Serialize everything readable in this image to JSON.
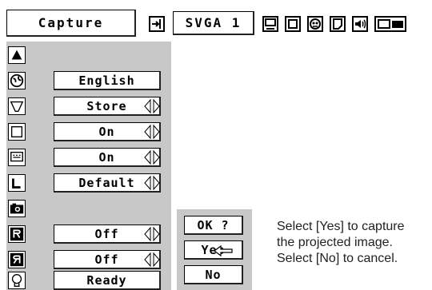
{
  "header": {
    "title": "Capture",
    "signal": "SVGA 1",
    "icons": [
      "input-icon",
      "screen-icon",
      "picture-icon",
      "color-icon",
      "image-adjust-icon",
      "sound-icon",
      "setting-icon"
    ]
  },
  "menu": {
    "items": [
      {
        "icon": "up-arrow-icon",
        "value": ""
      },
      {
        "icon": "globe-icon",
        "value": "English"
      },
      {
        "icon": "keystone-icon",
        "value": "Store"
      },
      {
        "icon": "blue-back-icon",
        "value": "On"
      },
      {
        "icon": "display-icon",
        "value": "On"
      },
      {
        "icon": "logo-icon",
        "value": "Default"
      },
      {
        "icon": "capture-icon",
        "value": ""
      },
      {
        "icon": "ceiling-icon",
        "value": "Off"
      },
      {
        "icon": "rear-icon",
        "value": "Off"
      },
      {
        "icon": "terminal-icon",
        "value": "Ready"
      }
    ]
  },
  "dialog": {
    "prompt": "OK ?",
    "yes": "Yes",
    "no": "No"
  },
  "instructions": {
    "line1": "Select [Yes] to capture",
    "line2": "the projected image.",
    "line3": "Select [No] to cancel."
  }
}
